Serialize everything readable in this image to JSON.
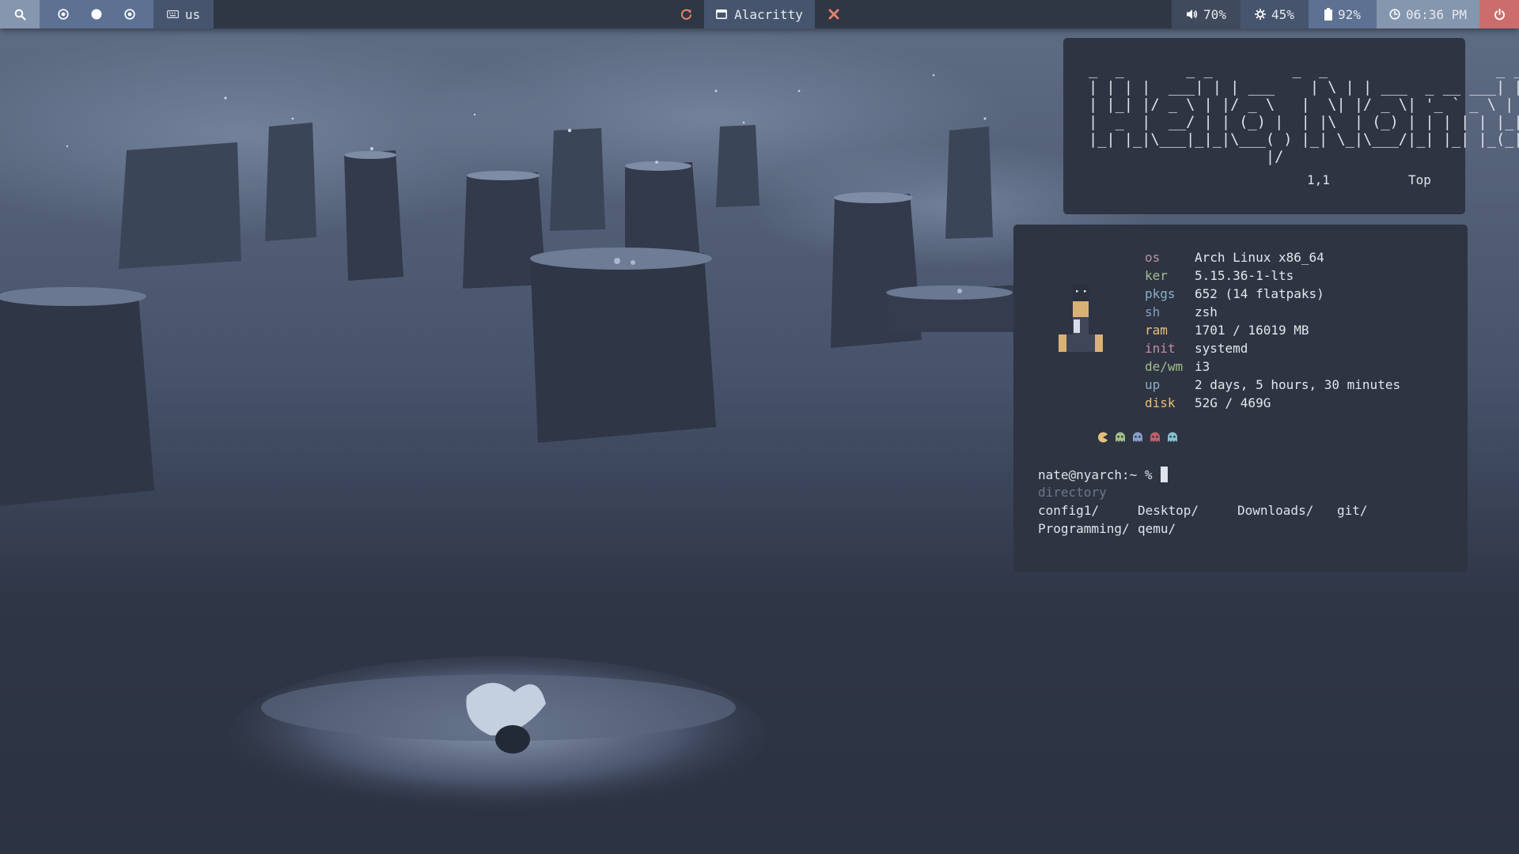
{
  "topbar": {
    "keyboard_layout": "us",
    "window_title": "Alacritty",
    "volume": "70%",
    "brightness": "45%",
    "battery": "92%",
    "clock": "06:36 PM",
    "workspaces": [
      {
        "icon": "circle-dot-icon",
        "active": false
      },
      {
        "icon": "filled-circle-icon",
        "active": true
      },
      {
        "icon": "circle-dot-icon",
        "active": false
      }
    ],
    "colors": {
      "bar_bg": "#2f3644",
      "accent_light": "#8596af",
      "accent_mid": "#5d7193",
      "accent_dark": "#46556d",
      "power": "#cb6d6d",
      "close": "#e2806e"
    }
  },
  "vim": {
    "ascii_art": "_  _       _ _         _  _                   _ _\n| | | |  ___| | | ___    | \\ | | ___  _ __ ___| | |\n| |_| |/ _ \\ | |/ _ \\   |  \\| |/ _ \\| '_ ` _ \\ | |\n|  _  |  __/ | | (_) |  | |\\  | (_) | | | | | |_|_|\n|_| |_|\\___|_|_|\\___( ) |_| \\_|\\___/|_| |_| |_(_|_)\n                    |/",
    "cursor_position": "1,1",
    "scroll_position": "Top"
  },
  "fetch": {
    "rows": [
      {
        "key": "os",
        "value": "Arch Linux x86_64",
        "color": "#c48ea4"
      },
      {
        "key": "ker",
        "value": "5.15.36-1-lts",
        "color": "#a3be8c"
      },
      {
        "key": "pkgs",
        "value": "652 (14 flatpaks)",
        "color": "#88b0c8"
      },
      {
        "key": "sh",
        "value": "zsh",
        "color": "#81a1c1"
      },
      {
        "key": "ram",
        "value": "1701 / 16019 MB",
        "color": "#e5c07b"
      },
      {
        "key": "init",
        "value": "systemd",
        "color": "#c48ea4"
      },
      {
        "key": "de/wm",
        "value": "i3",
        "color": "#a3be8c"
      },
      {
        "key": "up",
        "value": "2 days, 5 hours, 30 minutes",
        "color": "#88b0c8"
      },
      {
        "key": "disk",
        "value": "52G / 469G",
        "color": "#e5c07b"
      }
    ],
    "icons": [
      {
        "name": "pacman-icon",
        "color": "#e5c07b"
      },
      {
        "name": "ghost-icon",
        "color": "#a3be8c"
      },
      {
        "name": "ghost-icon",
        "color": "#88a0c8"
      },
      {
        "name": "ghost-icon",
        "color": "#bf616a"
      },
      {
        "name": "ghost-icon",
        "color": "#88c0d0"
      }
    ]
  },
  "terminal": {
    "prompt": "nate@nyarch:~ %",
    "hint": "directory",
    "entries": [
      "config1/",
      "Desktop/",
      "Downloads/",
      "git/",
      "Programming/",
      "qemu/"
    ]
  }
}
